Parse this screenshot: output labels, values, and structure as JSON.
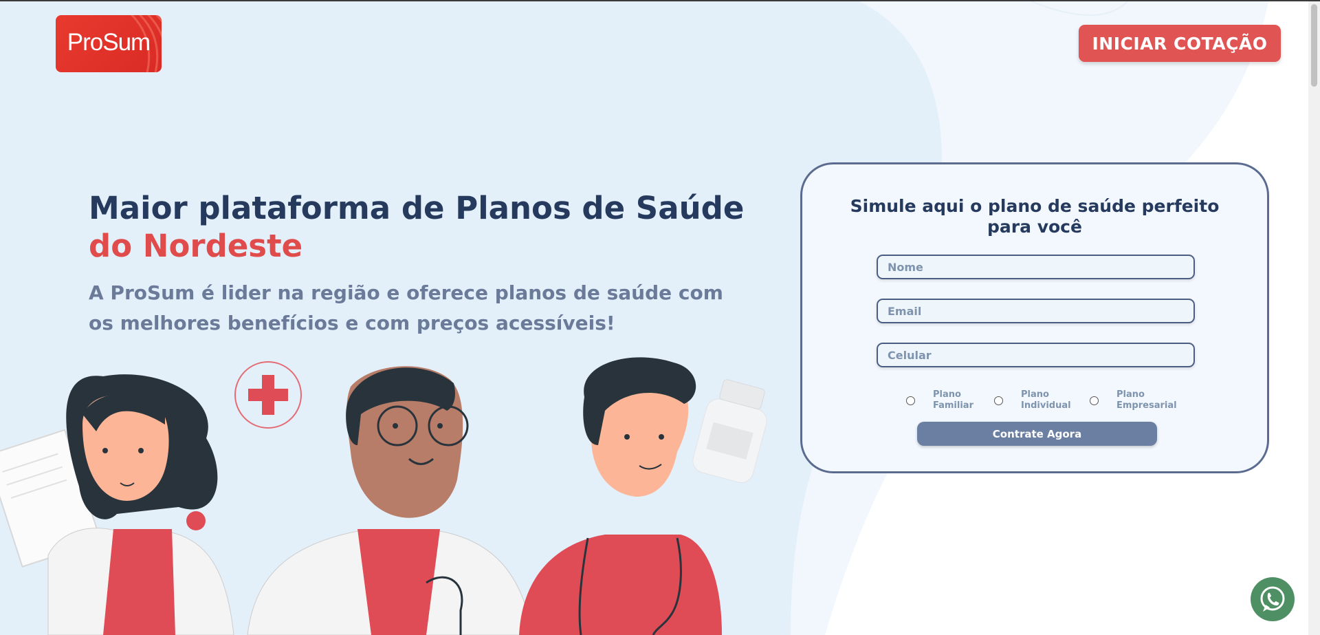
{
  "brand": {
    "logo_text": "ProSum"
  },
  "header": {
    "cta_label": "INICIAR COTAÇÃO"
  },
  "hero": {
    "headline": "Maior plataforma de Planos de Saúde",
    "headline_accent": "do Nordeste",
    "subtitle": "A ProSum é lider na região e oferece planos de saúde com os melhores benefícios e com preços acessíveis!"
  },
  "form": {
    "title": "Simule aqui o plano de saúde perfeito para você",
    "fields": {
      "nome_placeholder": "Nome",
      "email_placeholder": "Email",
      "celular_placeholder": "Celular"
    },
    "plan_options": [
      {
        "label": "Plano Familiar"
      },
      {
        "label": "Plano Individual"
      },
      {
        "label": "Plano Empresarial"
      }
    ],
    "submit_label": "Contrate Agora"
  },
  "floating": {
    "whatsapp_icon": "whatsapp-icon"
  },
  "colors": {
    "primary_dark": "#263a5e",
    "accent_red": "#e05454",
    "muted_blue": "#6b7a99",
    "background_light": "#e6f2fb",
    "whatsapp_green": "#4e8f63"
  }
}
